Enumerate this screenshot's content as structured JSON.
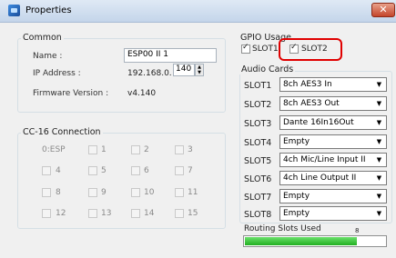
{
  "window": {
    "title": "Properties",
    "close_label": "✕"
  },
  "common": {
    "title": "Common",
    "name_label": "Name :",
    "name_value": "ESP00 II 1",
    "ip_label": "IP Address :",
    "ip_prefix": "192.168.0.",
    "ip_last": "140",
    "firmware_label": "Firmware Version :",
    "firmware_value": "v4.140"
  },
  "cc16": {
    "title": "CC-16 Connection",
    "items": [
      "0:ESP",
      "1",
      "2",
      "3",
      "4",
      "5",
      "6",
      "7",
      "8",
      "9",
      "10",
      "11",
      "12",
      "13",
      "14",
      "15"
    ]
  },
  "gpio": {
    "title": "GPIO Usage",
    "slot1": {
      "label": "SLOT1",
      "checked": true
    },
    "slot2": {
      "label": "SLOT2",
      "checked": true
    },
    "highlight_color": "#e00000"
  },
  "audio_cards": {
    "title": "Audio Cards",
    "slots": [
      {
        "label": "SLOT1",
        "value": "8ch AES3 In"
      },
      {
        "label": "SLOT2",
        "value": "8ch AES3 Out"
      },
      {
        "label": "SLOT3",
        "value": "Dante 16In16Out"
      },
      {
        "label": "SLOT4",
        "value": "Empty"
      },
      {
        "label": "SLOT5",
        "value": "4ch Mic/Line Input II"
      },
      {
        "label": "SLOT6",
        "value": "4ch Line Output II"
      },
      {
        "label": "SLOT7",
        "value": "Empty"
      },
      {
        "label": "SLOT8",
        "value": "Empty"
      }
    ]
  },
  "routing": {
    "label": "Routing Slots Used",
    "count": "8",
    "fill_fraction": 0.8,
    "bar_color": "#33cc33"
  },
  "icons": {
    "dropdown": "▼",
    "spin_up": "▲",
    "spin_down": "▼"
  }
}
